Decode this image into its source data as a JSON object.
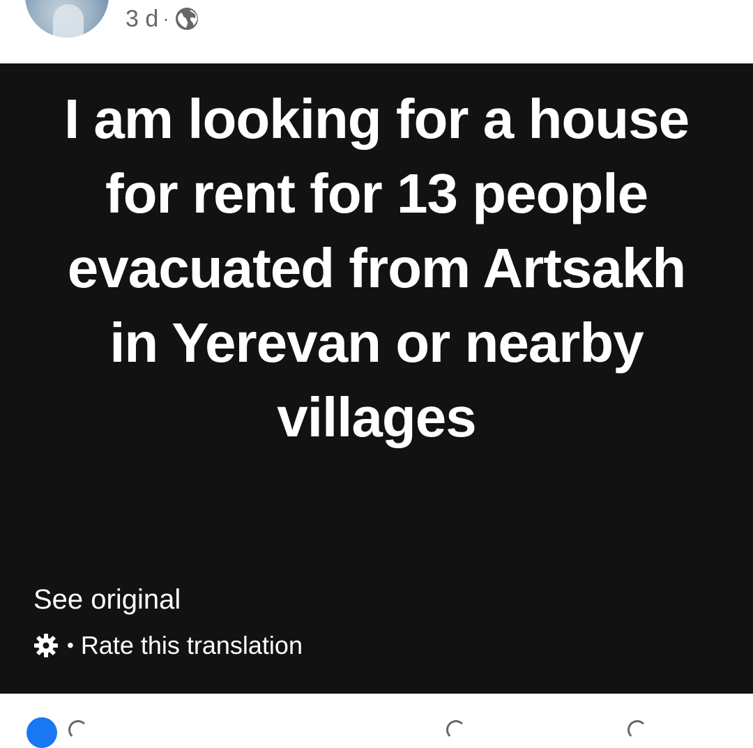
{
  "post_header": {
    "timestamp": "3 d",
    "separator": "·",
    "audience_icon": "globe-icon"
  },
  "post": {
    "text": "I am looking for a house for rent for 13 people evacuated from Artsakh in Yerevan or nearby villages",
    "background_color": "#121212",
    "text_color": "#ffffff"
  },
  "translation": {
    "see_original_label": "See original",
    "settings_icon": "gear-icon",
    "dot": "•",
    "rate_label": "Rate this translation"
  },
  "footer": {
    "reaction_icon": "like-reaction-icon",
    "accent_color": "#1877f2"
  }
}
